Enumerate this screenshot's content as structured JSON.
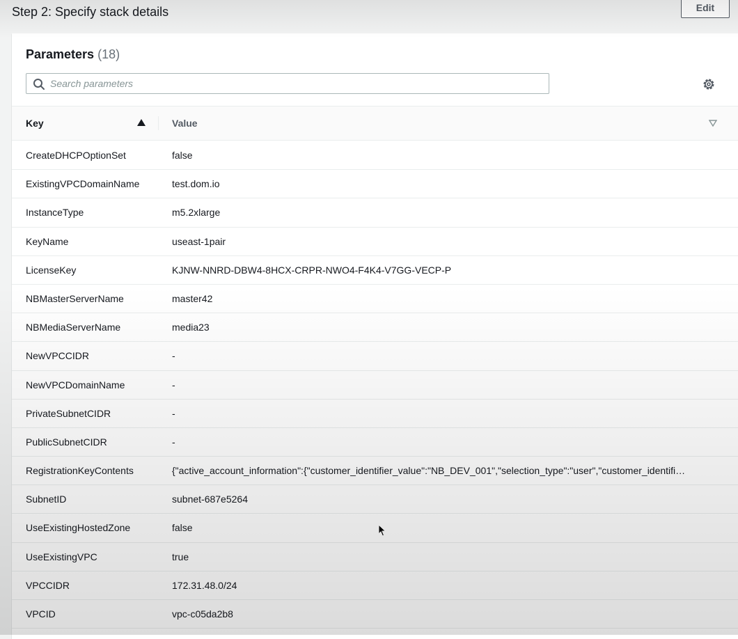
{
  "header": {
    "step_title": "Step 2: Specify stack details",
    "edit_label": "Edit"
  },
  "parameters": {
    "heading": "Parameters",
    "count": "(18)",
    "search_placeholder": "Search parameters",
    "search_value": "",
    "columns": {
      "key": "Key",
      "value": "Value"
    },
    "sort_column": "Key",
    "sort_direction": "ascending",
    "rows": [
      {
        "key": "CreateDHCPOptionSet",
        "value": "false"
      },
      {
        "key": "ExistingVPCDomainName",
        "value": "test.dom.io"
      },
      {
        "key": "InstanceType",
        "value": "m5.2xlarge"
      },
      {
        "key": "KeyName",
        "value": "useast-1pair"
      },
      {
        "key": "LicenseKey",
        "value": "KJNW-NNRD-DBW4-8HCX-CRPR-NWO4-F4K4-V7GG-VECP-P"
      },
      {
        "key": "NBMasterServerName",
        "value": "master42"
      },
      {
        "key": "NBMediaServerName",
        "value": "media23"
      },
      {
        "key": "NewVPCCIDR",
        "value": "-"
      },
      {
        "key": "NewVPCDomainName",
        "value": "-"
      },
      {
        "key": "PrivateSubnetCIDR",
        "value": "-"
      },
      {
        "key": "PublicSubnetCIDR",
        "value": "-"
      },
      {
        "key": "RegistrationKeyContents",
        "value": "{\"active_account_information\":{\"customer_identifier_value\":\"NB_DEV_001\",\"selection_type\":\"user\",\"customer_identifi…"
      },
      {
        "key": "SubnetID",
        "value": "subnet-687e5264"
      },
      {
        "key": "UseExistingHostedZone",
        "value": "false"
      },
      {
        "key": "UseExistingVPC",
        "value": "true"
      },
      {
        "key": "VPCCIDR",
        "value": "172.31.48.0/24"
      },
      {
        "key": "VPCID",
        "value": "vpc-c05da2b8"
      }
    ]
  },
  "icons": {
    "search": "search-icon",
    "settings": "gear-icon",
    "sort_key": "caret-up-icon",
    "sort_value": "caret-down-outline-icon",
    "pointer": "mouse-cursor-icon"
  },
  "colors": {
    "text": "#16191f",
    "muted": "#687078",
    "border": "#eaeded",
    "panel_bg": "#ffffff",
    "page_bg": "#f2f3f3"
  }
}
